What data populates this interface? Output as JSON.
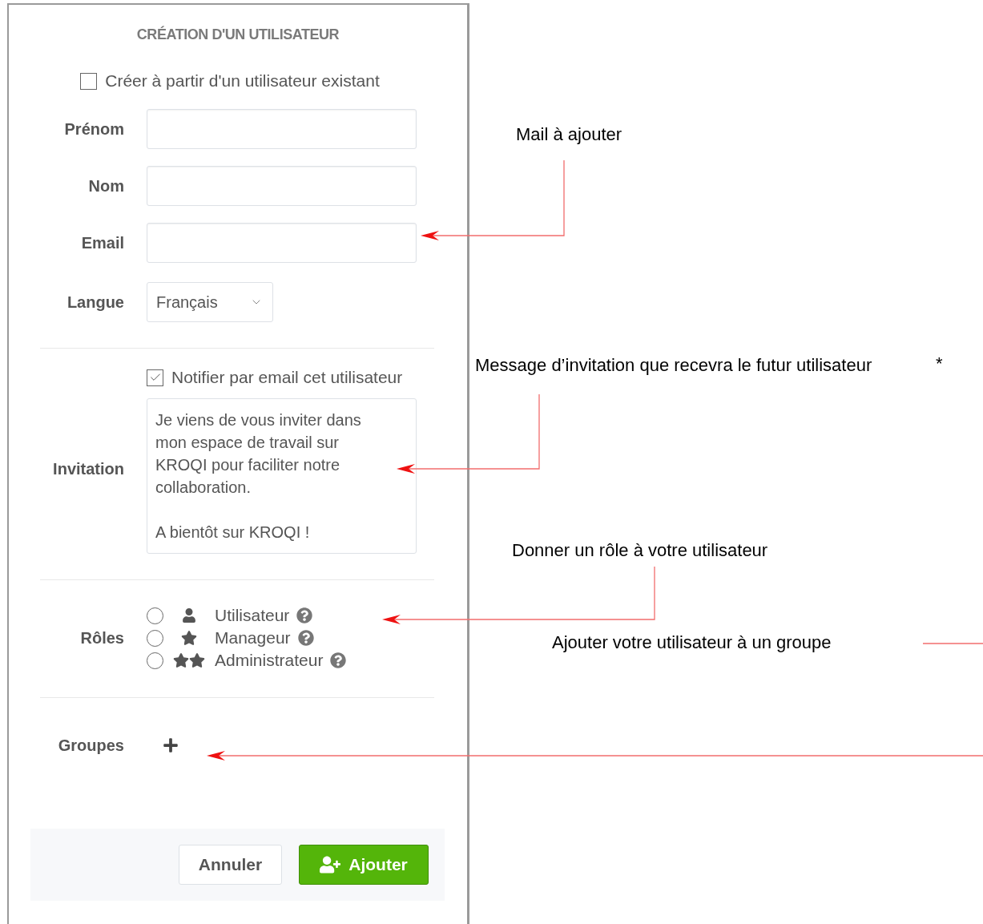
{
  "panel": {
    "title": "CRÉATION D'UN UTILISATEUR",
    "copy_option": {
      "label": "Créer à partir d'un utilisateur existant",
      "checked": false
    },
    "fields": [
      {
        "label": "Prénom",
        "kind": "text"
      },
      {
        "label": "Nom",
        "kind": "text"
      },
      {
        "label": "Email",
        "kind": "text"
      },
      {
        "label": "Langue",
        "kind": "select",
        "value": "Français"
      }
    ],
    "invitation": {
      "label": "Invitation",
      "notify": {
        "label": "Notifier par email cet utilisateur",
        "checked": true
      },
      "message": "Je viens de vous inviter dans mon espace de travail sur KROQI pour faciliter notre collaboration.\n\nA bientôt sur KROQI !"
    },
    "roles": {
      "label": "Rôles",
      "options": [
        {
          "label": "Utilisateur",
          "kind": "user",
          "selected": false
        },
        {
          "label": "Manageur",
          "kind": "star",
          "selected": false
        },
        {
          "label": "Administrateur",
          "kind": "double-star",
          "selected": false
        }
      ]
    },
    "groups": {
      "label": "Groupes"
    },
    "buttons": [
      {
        "label": "Annuler",
        "kind": "secondary"
      },
      {
        "label": "Ajouter",
        "kind": "primary"
      }
    ]
  },
  "annotations": [
    {
      "text": "Mail à ajouter"
    },
    {
      "text": "Message d’invitation que recevra le futur utilisateur"
    },
    {
      "text": "*"
    },
    {
      "text": "Donner un rôle à votre utilisateur"
    },
    {
      "text": "Ajouter votre utilisateur à un groupe"
    }
  ]
}
